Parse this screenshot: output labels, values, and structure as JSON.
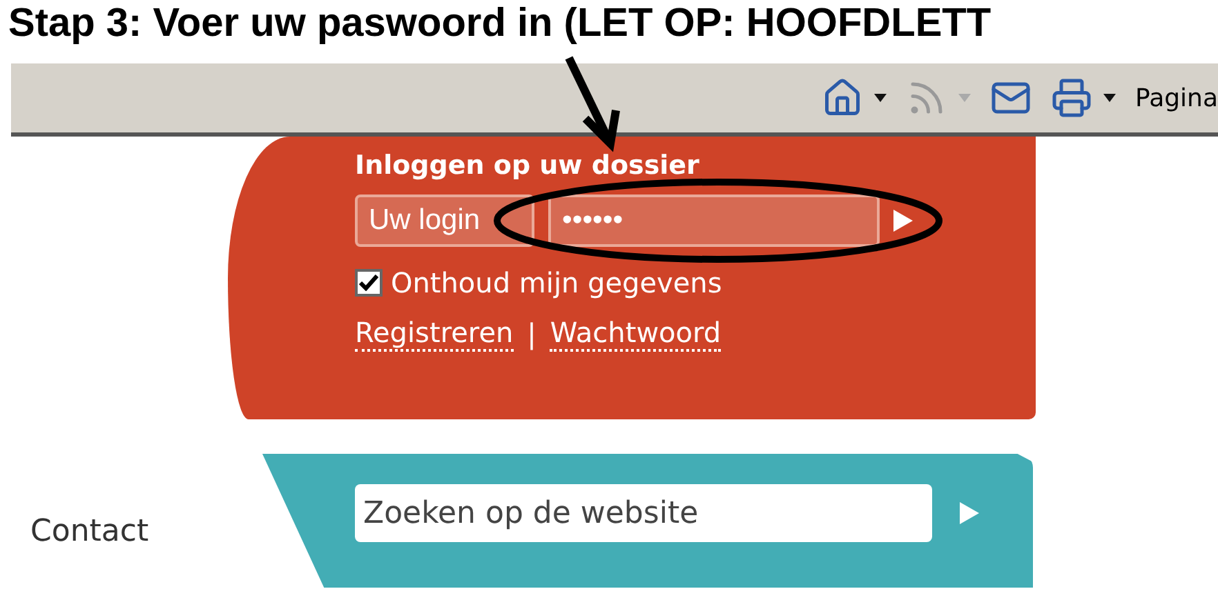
{
  "caption": "Stap 3: Voer uw paswoord in (LET OP: HOOFDLETT",
  "toolbar": {
    "buttons": [
      {
        "kind": "home",
        "dropdown": true,
        "disabled": false
      },
      {
        "kind": "feed",
        "dropdown": true,
        "disabled": true
      },
      {
        "kind": "mail",
        "dropdown": false,
        "disabled": false
      },
      {
        "kind": "print",
        "dropdown": true,
        "disabled": false
      }
    ],
    "page_menu": "Pagina"
  },
  "login": {
    "title": "Inloggen op uw dossier",
    "username_placeholder": "Uw login",
    "password_value": "••••••",
    "remember": {
      "label": "Onthoud mijn gegevens",
      "checked": true
    },
    "links": [
      "Registreren",
      "Wachtwoord"
    ],
    "separator": "|"
  },
  "nav": {
    "item": "Contact"
  },
  "search": {
    "placeholder": "Zoeken op de website"
  }
}
